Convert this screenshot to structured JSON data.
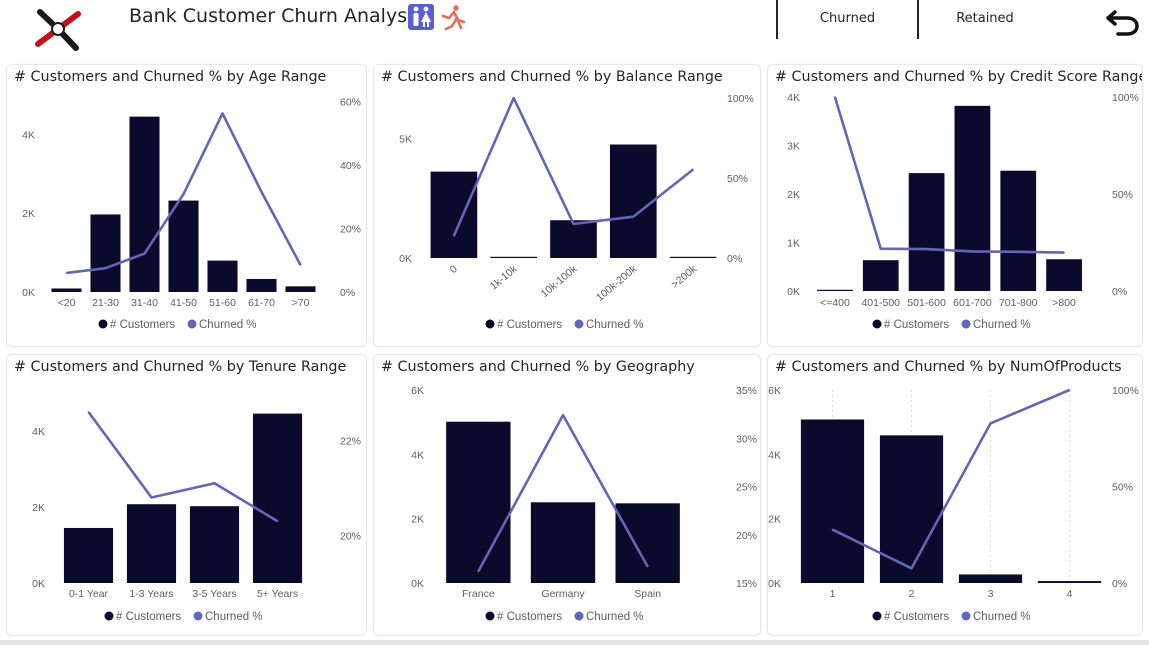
{
  "header": {
    "title": "Bank Customer Churn Analysis",
    "buttons": [
      "Churned",
      "Retained"
    ]
  },
  "colors": {
    "bar": "#0a0a2c",
    "line": "#6266b5",
    "axis_text": "#605e5c",
    "gridline": "#dcdcdc"
  },
  "legend": {
    "bars": "# Customers",
    "line": "Churned %"
  },
  "chart_data": [
    {
      "type": "bar",
      "title": "# Customers and Churned % by Age Range",
      "categories": [
        "<20",
        "21-30",
        "31-40",
        "41-50",
        "51-60",
        "61-70",
        ">70"
      ],
      "series": [
        {
          "name": "# Customers",
          "values": [
            89,
            1968,
            4451,
            2320,
            797,
            331,
            144
          ]
        },
        {
          "name": "Churned %",
          "values": [
            6.0,
            7.5,
            12.1,
            30.8,
            56.2,
            31.5,
            8.5
          ]
        }
      ],
      "y_ticks": [
        "0K",
        "2K",
        "4K"
      ],
      "y2_ticks": [
        "0%",
        "20%",
        "40%",
        "60%"
      ],
      "ylim": [
        0,
        5000
      ],
      "y2lim": [
        0,
        62
      ]
    },
    {
      "type": "bar",
      "title": "# Customers and Churned % by Balance Range",
      "categories": [
        "0",
        "1k-10k",
        "10k-100k",
        "100k-200k",
        ">200k"
      ],
      "series": [
        {
          "name": "# Customers",
          "values": [
            3617,
            2,
            1582,
            4752,
            47
          ]
        },
        {
          "name": "Churned %",
          "values": [
            13.8,
            100,
            21.3,
            25.8,
            55.3
          ]
        }
      ],
      "y_ticks": [
        "0K",
        "5K"
      ],
      "y2_ticks": [
        "0%",
        "50%",
        "100%"
      ],
      "ylim": [
        0,
        6700
      ],
      "y2lim": [
        0,
        100
      ]
    },
    {
      "type": "bar",
      "title": "# Customers and Churned % by Credit Score Range",
      "categories": [
        "<=400",
        "401-500",
        "501-600",
        "601-700",
        "701-800",
        ">800"
      ],
      "series": [
        {
          "name": "# Customers",
          "values": [
            19,
            635,
            2431,
            3818,
            2480,
            655
          ]
        },
        {
          "name": "Churned %",
          "values": [
            100,
            21.8,
            21.6,
            20.4,
            20.2,
            19.8
          ]
        }
      ],
      "y_ticks": [
        "0K",
        "1K",
        "2K",
        "3K",
        "4K"
      ],
      "y2_ticks": [
        "0%",
        "50%",
        "100%"
      ],
      "ylim": [
        0,
        4000
      ],
      "y2lim": [
        0,
        100
      ]
    },
    {
      "type": "bar",
      "title": "# Customers and Churned % by Tenure Range",
      "categories": [
        "0-1 Year",
        "1-3 Years",
        "3-5 Years",
        "5+ Years"
      ],
      "series": [
        {
          "name": "# Customers",
          "values": [
            1448,
            2073,
            2021,
            4458
          ]
        },
        {
          "name": "Churned %",
          "values": [
            22.6,
            20.8,
            21.1,
            20.3
          ]
        }
      ],
      "y_ticks": [
        "0K",
        "2K",
        "4K"
      ],
      "y2_ticks": [
        "20%",
        "22%"
      ],
      "ylim": [
        0,
        5000
      ],
      "y2lim": [
        19.0,
        23.0
      ]
    },
    {
      "type": "bar",
      "title": "# Customers and Churned % by Geography",
      "categories": [
        "France",
        "Germany",
        "Spain"
      ],
      "series": [
        {
          "name": "# Customers",
          "values": [
            5014,
            2509,
            2477
          ]
        },
        {
          "name": "Churned %",
          "values": [
            16.2,
            32.4,
            16.7
          ]
        }
      ],
      "y_ticks": [
        "0K",
        "2K",
        "4K",
        "6K"
      ],
      "y2_ticks": [
        "15%",
        "20%",
        "25%",
        "30%",
        "35%"
      ],
      "ylim": [
        0,
        6000
      ],
      "y2lim": [
        15,
        35
      ]
    },
    {
      "type": "bar",
      "title": "# Customers and Churned % by NumOfProducts",
      "categories": [
        "1",
        "2",
        "3",
        "4"
      ],
      "series": [
        {
          "name": "# Customers",
          "values": [
            5084,
            4590,
            266,
            60
          ]
        },
        {
          "name": "Churned %",
          "values": [
            27.7,
            7.6,
            82.7,
            100
          ]
        }
      ],
      "y_ticks": [
        "0K",
        "2K",
        "4K",
        "6K"
      ],
      "y2_ticks": [
        "0%",
        "50%",
        "100%"
      ],
      "ylim": [
        0,
        6000
      ],
      "y2lim": [
        0,
        100
      ]
    }
  ]
}
